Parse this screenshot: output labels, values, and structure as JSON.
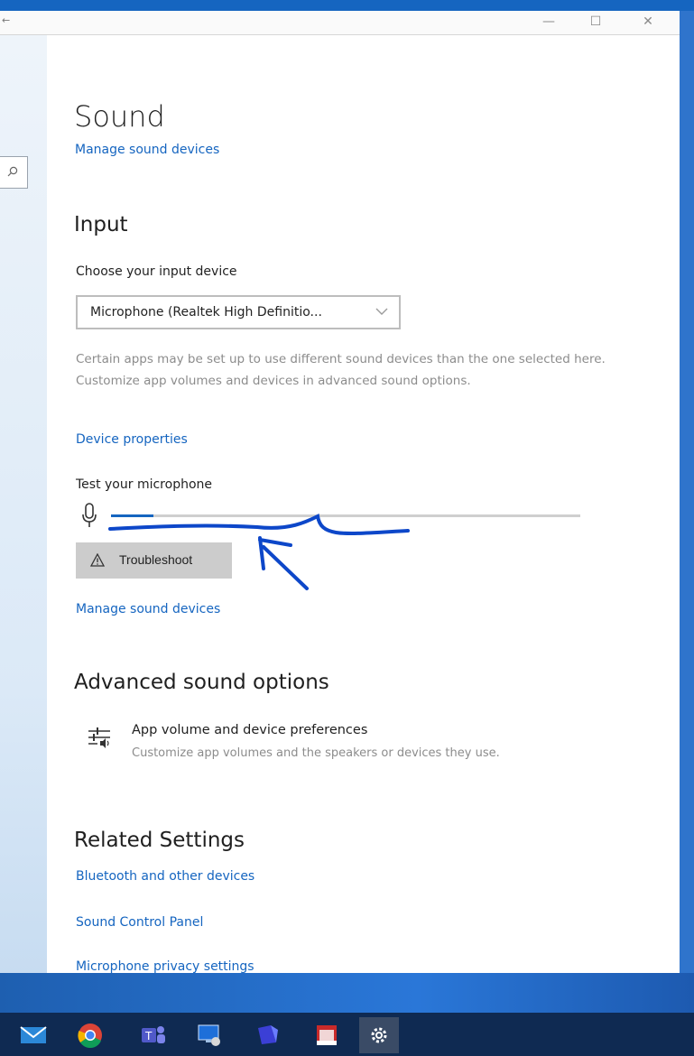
{
  "page": {
    "title": "Sound",
    "top_link": "Manage sound devices"
  },
  "input": {
    "heading": "Input",
    "choose_label": "Choose your input device",
    "device_value": "Microphone (Realtek High Definitio...",
    "note": "Certain apps may be set up to use different sound devices than the one selected here. Customize app volumes and devices in advanced sound options.",
    "device_properties": "Device properties",
    "test_label": "Test your microphone",
    "mic_level": 0.09,
    "troubleshoot": "Troubleshoot",
    "manage_link": "Manage sound devices"
  },
  "advanced": {
    "heading": "Advanced sound options",
    "item_title": "App volume and device preferences",
    "item_desc": "Customize app volumes and the speakers or devices they use."
  },
  "related": {
    "heading": "Related Settings",
    "links": [
      "Bluetooth and other devices",
      "Sound Control Panel",
      "Microphone privacy settings"
    ]
  },
  "taskbar": {
    "icons": [
      "mail-icon",
      "chrome-icon",
      "teams-icon",
      "remote-desktop-icon",
      "app-icon",
      "acrobat-icon",
      "settings-gear-icon"
    ]
  },
  "colors": {
    "accent": "#1565c0",
    "annotation": "#0d47c9"
  }
}
